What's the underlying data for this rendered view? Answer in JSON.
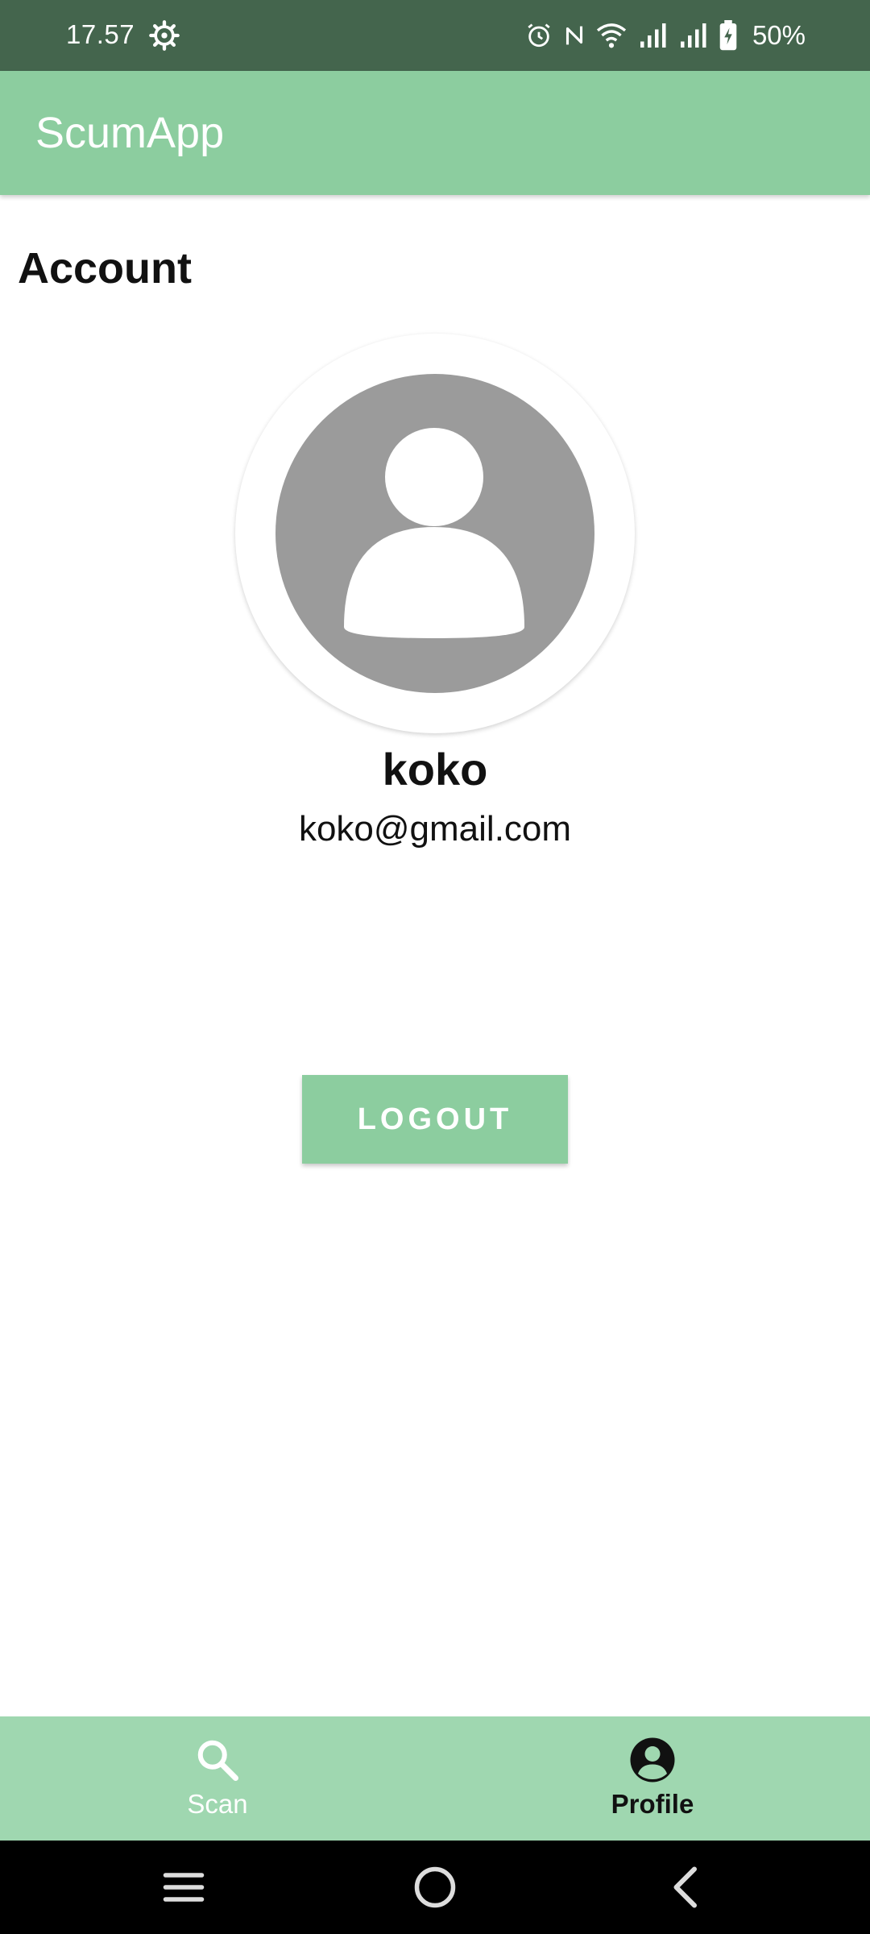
{
  "status_bar": {
    "time": "17.57",
    "battery_percent": "50%",
    "icons": [
      "gear-icon",
      "alarm-icon",
      "nfc-icon",
      "wifi-icon",
      "signal-icon",
      "signal-icon",
      "battery-charging-icon"
    ]
  },
  "app_bar": {
    "title": "ScumApp"
  },
  "account": {
    "section_title": "Account",
    "avatar_icon": "person-icon",
    "name": "koko",
    "email": "koko@gmail.com",
    "logout_label": "LOGOUT"
  },
  "bottom_nav": {
    "items": [
      {
        "label": "Scan",
        "icon": "search-icon",
        "selected": false
      },
      {
        "label": "Profile",
        "icon": "account-circle-icon",
        "selected": true
      }
    ]
  },
  "system_nav": {
    "buttons": [
      "menu-icon",
      "home-icon",
      "back-icon"
    ]
  },
  "colors": {
    "status_bar": "#44654d",
    "primary": "#8ccd9f",
    "bottom_nav": "#9fd7b0",
    "avatar_gray": "#9b9b9b"
  }
}
